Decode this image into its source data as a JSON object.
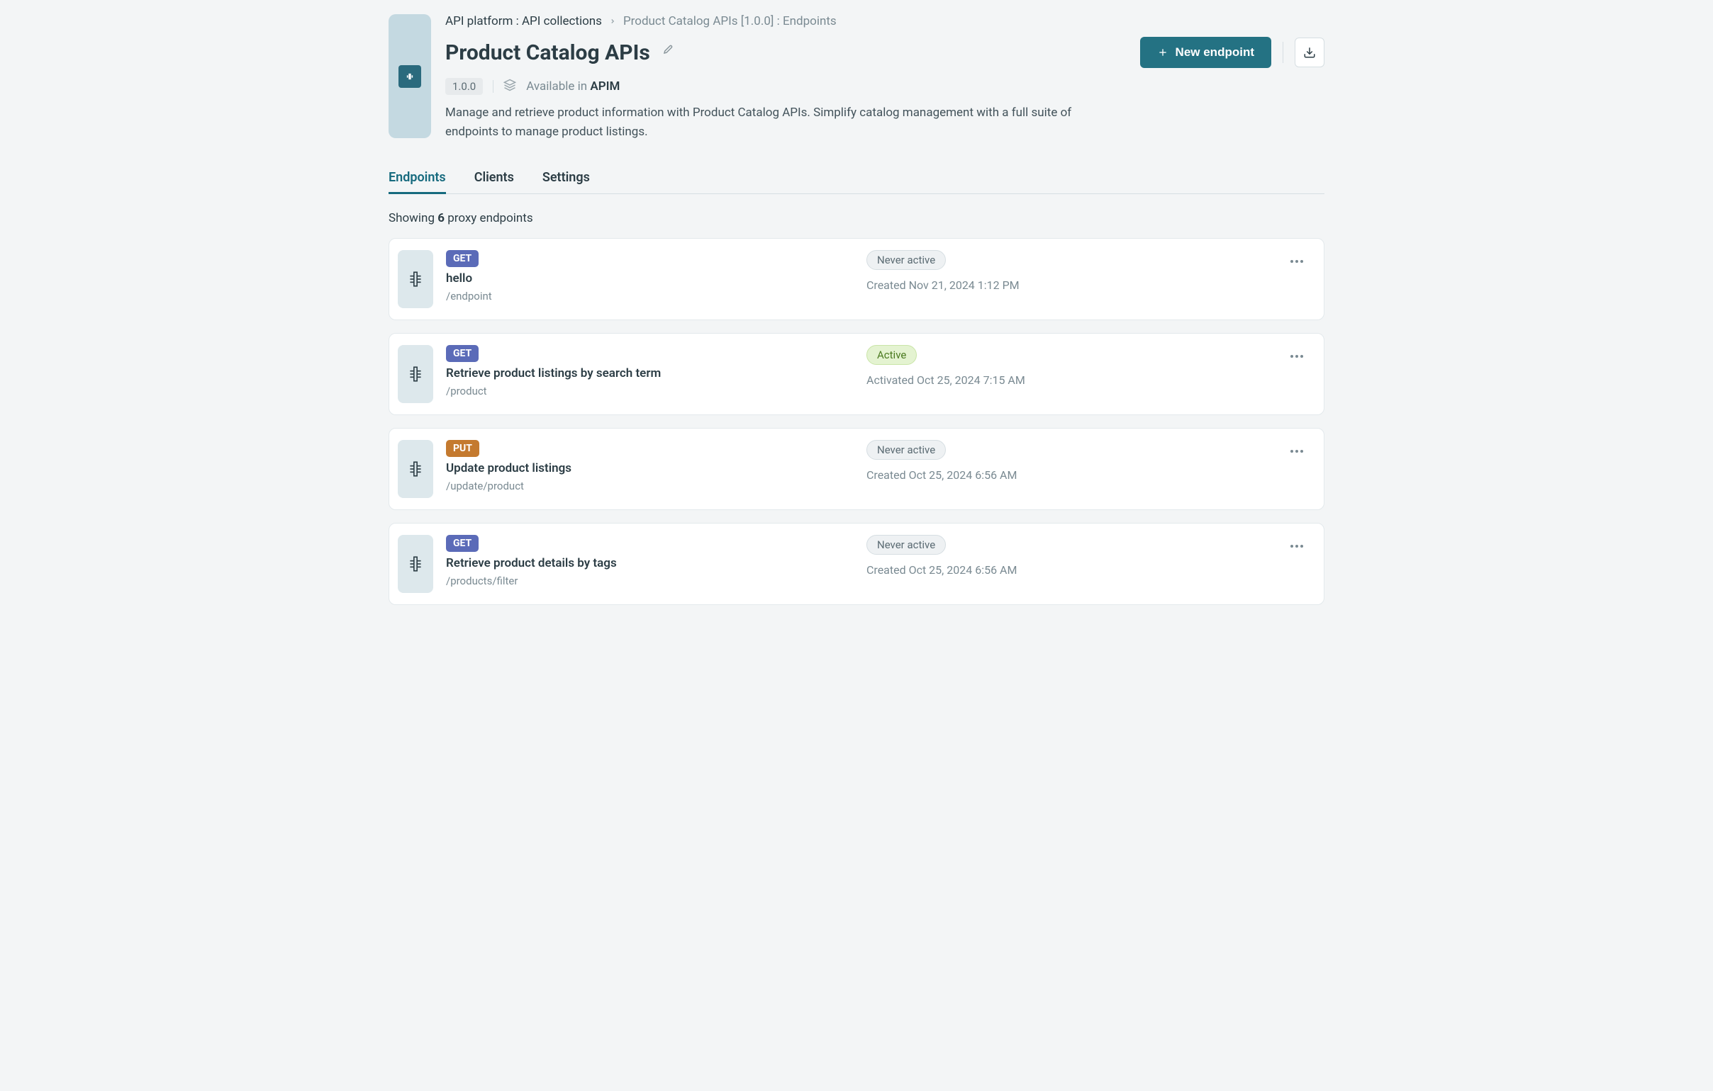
{
  "breadcrumb": {
    "root": "API platform : API collections",
    "current": "Product Catalog APIs [1.0.0] : Endpoints"
  },
  "title": "Product Catalog APIs",
  "version": "1.0.0",
  "availability_prefix": "Available in ",
  "availability_target": "APIM",
  "description": "Manage and retrieve product information with Product Catalog APIs. Simplify catalog management with a full suite of endpoints to manage product listings.",
  "actions": {
    "new_endpoint": "New endpoint"
  },
  "tabs": [
    {
      "id": "endpoints",
      "label": "Endpoints",
      "active": true
    },
    {
      "id": "clients",
      "label": "Clients",
      "active": false
    },
    {
      "id": "settings",
      "label": "Settings",
      "active": false
    }
  ],
  "showing": {
    "prefix": "Showing ",
    "count": "6",
    "suffix": " proxy endpoints"
  },
  "endpoints": [
    {
      "method": "GET",
      "name": "hello",
      "path": "/endpoint",
      "status": "Never active",
      "status_kind": "never",
      "timestamp": "Created Nov 21, 2024 1:12 PM"
    },
    {
      "method": "GET",
      "name": "Retrieve product listings by search term",
      "path": "/product",
      "status": "Active",
      "status_kind": "active",
      "timestamp": "Activated Oct 25, 2024 7:15 AM"
    },
    {
      "method": "PUT",
      "name": "Update product listings",
      "path": "/update/product",
      "status": "Never active",
      "status_kind": "never",
      "timestamp": "Created Oct 25, 2024 6:56 AM"
    },
    {
      "method": "GET",
      "name": "Retrieve product details by tags",
      "path": "/products/filter",
      "status": "Never active",
      "status_kind": "never",
      "timestamp": "Created Oct 25, 2024 6:56 AM"
    }
  ]
}
